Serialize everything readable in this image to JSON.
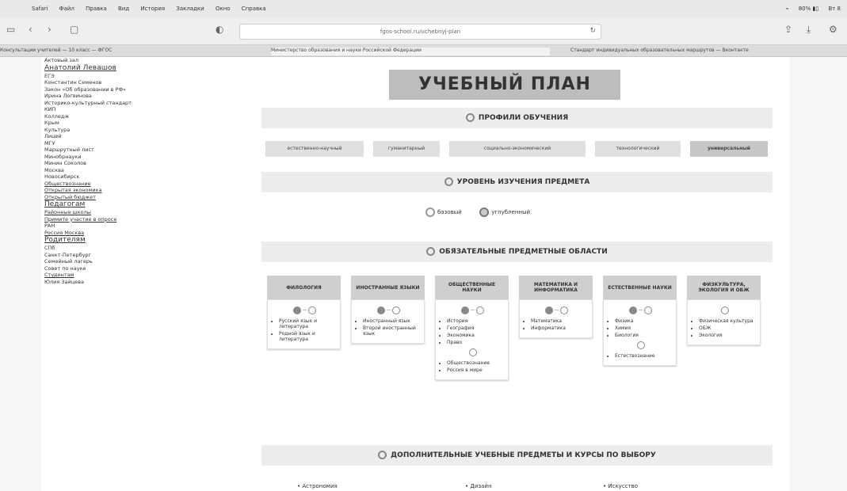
{
  "menubar": {
    "menus": [
      "Safari",
      "Файл",
      "Правка",
      "Вид",
      "История",
      "Закладки",
      "Окно",
      "Справка"
    ],
    "status": [
      "⌁",
      "80% ▮▯",
      "Вт 8"
    ]
  },
  "toolbar": {
    "url": "fgos-school.ru/uchebnyj-plan"
  },
  "tabs": [
    "Консультации учителей — 10 класс — ФГОС",
    "Министерство образования и науки Российской Федерации",
    "Стандарт индивидуальных образовательных маршрутов — Вконтакте"
  ],
  "sidebar": {
    "items": [
      {
        "label": "Актовый зал",
        "style": "plain"
      },
      {
        "label": "Анатолий Левашов",
        "style": "big"
      },
      {
        "label": "ЕГЭ",
        "style": "plain"
      },
      {
        "label": "Константин Семенов",
        "style": "plain"
      },
      {
        "label": "Закон «Об образовании в РФ»",
        "style": "plain"
      },
      {
        "label": "Ирина Логвинова",
        "style": "plain"
      },
      {
        "label": "Историко-культурный стандарт",
        "style": "plain"
      },
      {
        "label": "КИП",
        "style": "plain"
      },
      {
        "label": "Колледж",
        "style": "plain"
      },
      {
        "label": "Крым",
        "style": "plain"
      },
      {
        "label": "Культура",
        "style": "plain"
      },
      {
        "label": "Лицей",
        "style": "plain"
      },
      {
        "label": "МГУ",
        "style": "plain"
      },
      {
        "label": "Маршрутный лист",
        "style": "plain"
      },
      {
        "label": "Минобрнауки",
        "style": "plain"
      },
      {
        "label": "Минин Соколов",
        "style": "plain"
      },
      {
        "label": "Москва",
        "style": "plain"
      },
      {
        "label": "Новосибирск",
        "style": "plain"
      },
      {
        "label": "Обществознание",
        "style": "u"
      },
      {
        "label": "Открытая экономика",
        "style": "u"
      },
      {
        "label": "Открытый бюджет",
        "style": "u"
      },
      {
        "label": "Педагогам",
        "style": "big"
      },
      {
        "label": "Районные школы",
        "style": "u"
      },
      {
        "label": "Примите участие в опросе",
        "style": "u"
      },
      {
        "label": "РАН",
        "style": "plain"
      },
      {
        "label": "Россия Москва",
        "style": "u"
      },
      {
        "label": "Родителям",
        "style": "big"
      },
      {
        "label": "СПб",
        "style": "plain"
      },
      {
        "label": "Санкт-Петербург",
        "style": "plain"
      },
      {
        "label": "Семейный лагерь",
        "style": "plain"
      },
      {
        "label": "Совет по науке",
        "style": "plain"
      },
      {
        "label": "Студентам",
        "style": "u"
      },
      {
        "label": "Юлия Зайцева",
        "style": "plain"
      }
    ]
  },
  "main": {
    "title": "УЧЕБНЫЙ ПЛАН",
    "profiles_header": "ПРОФИЛИ ОБУЧЕНИЯ",
    "profiles": [
      {
        "label": "естественно-научный",
        "selected": false
      },
      {
        "label": "гуманитарный",
        "selected": false
      },
      {
        "label": "социально-экономический",
        "selected": false
      },
      {
        "label": "технологический",
        "selected": false
      },
      {
        "label": "универсальный",
        "selected": true
      }
    ],
    "level_header": "УРОВЕНЬ ИЗУЧЕНИЯ ПРЕДМЕТА",
    "levels": [
      {
        "label": "базовый",
        "selected": false
      },
      {
        "label": "углубленный",
        "selected": true
      }
    ],
    "areas_header": "ОБЯЗАТЕЛЬНЫЕ ПРЕДМЕТНЫЕ ОБЛАСТИ",
    "areas": [
      {
        "title": "ФИЛОЛОГИЯ",
        "groups": [
          [
            "Русский язык и литература",
            "Родной язык и литература"
          ]
        ]
      },
      {
        "title": "ИНОСТРАННЫЕ ЯЗЫКИ",
        "groups": [
          [
            "Иностранный язык",
            "Второй иностранный язык"
          ]
        ]
      },
      {
        "title": "ОБЩЕСТВЕННЫЕ НАУКИ",
        "groups": [
          [
            "История",
            "География",
            "Экономика",
            "Право"
          ],
          [
            "Обществознание",
            "Россия в мире"
          ]
        ]
      },
      {
        "title": "МАТЕМАТИКА И ИНФОРМАТИКА",
        "groups": [
          [
            "Математика",
            "Информатика"
          ]
        ]
      },
      {
        "title": "ЕСТЕСТВЕННЫЕ НАУКИ",
        "groups": [
          [
            "Физика",
            "Химия",
            "Биология"
          ],
          [
            "Естествознание"
          ]
        ]
      },
      {
        "title": "ФИЗКУЛЬТУРА, ЭКОЛОГИЯ И ОБЖ",
        "groups": [
          [
            "Физическая культура",
            "ОБЖ",
            "Экология"
          ]
        ]
      }
    ],
    "electives_header": "ДОПОЛНИТЕЛЬНЫЕ УЧЕБНЫЕ ПРЕДМЕТЫ И КУРСЫ ПО ВЫБОРУ",
    "electives": [
      "Астрономия",
      "Дизайн",
      "Искусство"
    ]
  }
}
